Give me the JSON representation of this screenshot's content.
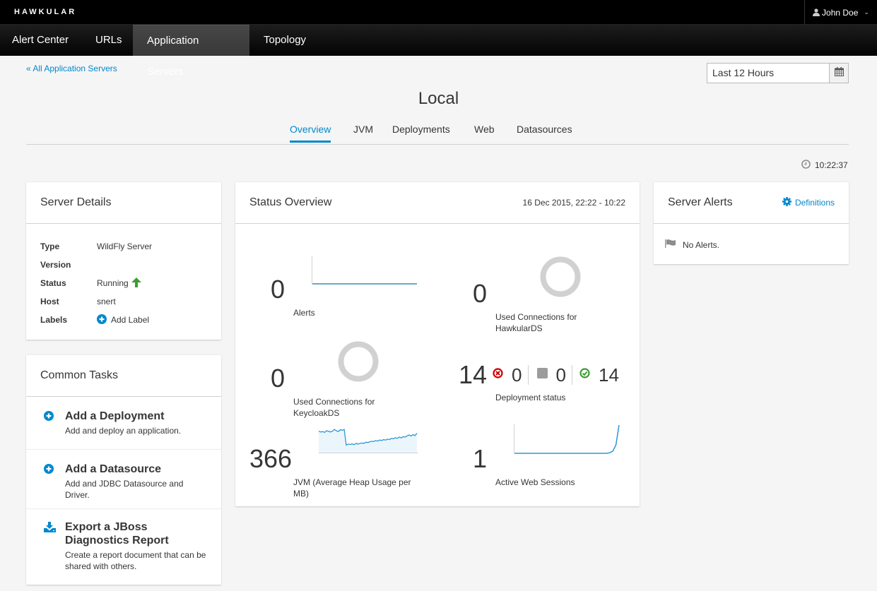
{
  "app": {
    "brand": "HAWKULAR",
    "user": "John Doe"
  },
  "nav": {
    "items": [
      {
        "label": "Alert Center"
      },
      {
        "label": "URLs"
      },
      {
        "label": "Application Servers",
        "active": true
      },
      {
        "label": "Topology"
      }
    ]
  },
  "breadcrumb": "« All Application Servers",
  "time_range": {
    "value": "Last 12 Hours"
  },
  "page_title": "Local",
  "tabs": [
    {
      "label": "Overview",
      "active": true
    },
    {
      "label": "JVM"
    },
    {
      "label": "Deployments"
    },
    {
      "label": "Web"
    },
    {
      "label": "Datasources"
    }
  ],
  "clock": "10:22:37",
  "server_details": {
    "title": "Server Details",
    "rows": [
      {
        "key": "Type",
        "value": "WildFly Server"
      },
      {
        "key": "Version",
        "value": ""
      },
      {
        "key": "Status",
        "value": "Running"
      },
      {
        "key": "Host",
        "value": "snert"
      },
      {
        "key": "Labels",
        "value": "Add Label"
      }
    ]
  },
  "common_tasks": {
    "title": "Common Tasks",
    "items": [
      {
        "title": "Add a Deployment",
        "desc": "Add and deploy an application.",
        "icon": "plus-circle-icon"
      },
      {
        "title": "Add a Datasource",
        "desc": "Add and JDBC Datasource and Driver.",
        "icon": "plus-circle-icon"
      },
      {
        "title": "Export a JBoss Diagnostics Report",
        "desc": "Create a report document that can be shared with others.",
        "icon": "download-icon"
      }
    ]
  },
  "status_overview": {
    "title": "Status Overview",
    "range": "16 Dec 2015, 22:22 - 10:22",
    "metrics": {
      "alerts": {
        "value": "0",
        "label": "Alerts"
      },
      "hawkular_ds": {
        "value": "0",
        "label": "Used Connections for HawkularDS"
      },
      "keycloak_ds": {
        "value": "0",
        "label": "Used Connections for KeycloakDS"
      },
      "deployments": {
        "value": "14",
        "failed": "0",
        "stopped": "0",
        "ok": "14",
        "label": "Deployment status"
      },
      "jvm": {
        "value": "366",
        "label": "JVM (Average Heap Usage per MB)"
      },
      "web_sessions": {
        "value": "1",
        "label": "Active Web Sessions"
      }
    },
    "sparklines": {
      "jvm": [
        0.78,
        0.74,
        0.76,
        0.72,
        0.8,
        0.77,
        0.74,
        0.78,
        0.86,
        0.8,
        0.76,
        0.85,
        0.82,
        0.86,
        0.12,
        0.17,
        0.15,
        0.18,
        0.14,
        0.2,
        0.17,
        0.2,
        0.22,
        0.2,
        0.26,
        0.24,
        0.28,
        0.3,
        0.29,
        0.34,
        0.31,
        0.36,
        0.34,
        0.38,
        0.36,
        0.4,
        0.38,
        0.44,
        0.42,
        0.47,
        0.44,
        0.5,
        0.46,
        0.52,
        0.5,
        0.56,
        0.6,
        0.55,
        0.62,
        0.57,
        0.68
      ],
      "web_sessions": [
        0,
        0,
        0,
        0,
        0,
        0,
        0,
        0,
        0,
        0,
        0,
        0,
        0,
        0,
        0,
        0,
        0,
        0,
        0,
        0,
        0,
        0,
        0,
        0,
        0,
        0,
        0,
        0,
        0,
        0,
        0,
        0.02,
        0.08,
        0.3,
        1.0
      ],
      "alerts": [
        0,
        0,
        0,
        0,
        0,
        0,
        0,
        0,
        0,
        0
      ]
    }
  },
  "server_alerts": {
    "title": "Server Alerts",
    "definitions_label": "Definitions",
    "empty_text": "No Alerts."
  },
  "colors": {
    "accent": "#0088ce",
    "success": "#3f9c35",
    "danger": "#cc0000",
    "muted": "#d1d1d1"
  }
}
